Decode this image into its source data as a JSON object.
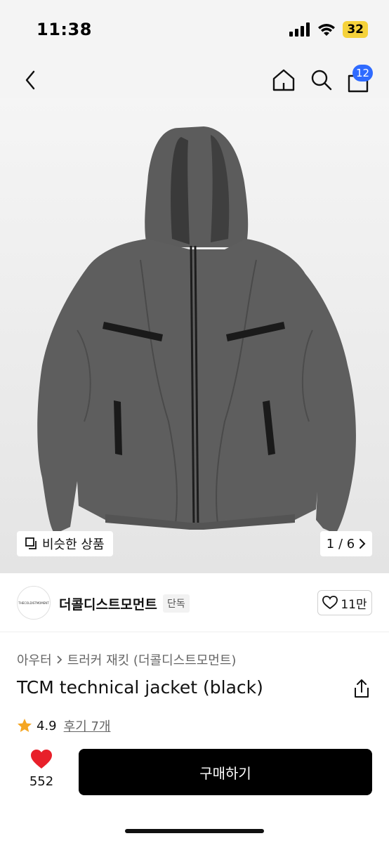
{
  "status_bar": {
    "time": "11:38",
    "battery": "32"
  },
  "nav": {
    "cart_count": "12"
  },
  "gallery": {
    "similar_label": "비슷한 상품",
    "page_indicator": "1 / 6"
  },
  "store": {
    "logo_text": "THECOLDISTMOMENT",
    "name": "더콜디스트모먼트",
    "tag": "단독",
    "likes": "11만"
  },
  "breadcrumb": {
    "category": "아우터",
    "subcategory": "트러커 재킷 (더콜디스트모먼트)"
  },
  "product": {
    "title": "TCM technical jacket (black)"
  },
  "rating": {
    "value": "4.9",
    "reviews": "후기 7개"
  },
  "bottom": {
    "heart_count": "552",
    "buy_label": "구매하기"
  },
  "colors": {
    "accent_blue": "#2f6bff",
    "heart_red": "#e8202a",
    "star_orange": "#f5a623",
    "buy_bg": "#000000"
  }
}
